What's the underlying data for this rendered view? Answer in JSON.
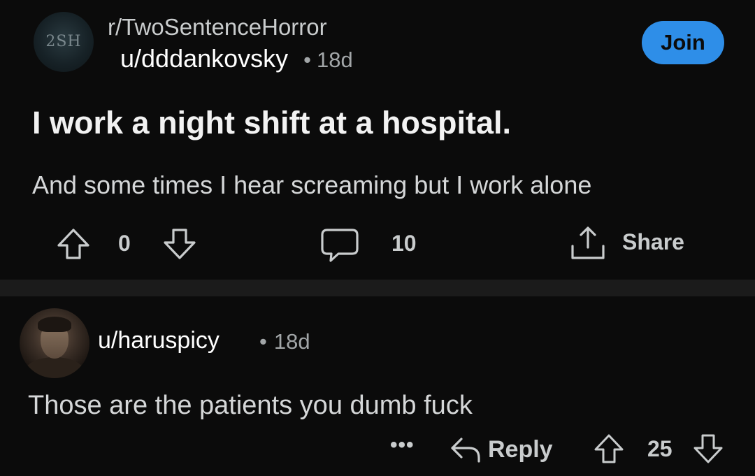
{
  "post": {
    "subreddit_avatar_text": "2SH",
    "subreddit": "r/TwoSentenceHorror",
    "author": "u/dddankovsky",
    "separator": "•",
    "age": "18d",
    "join_label": "Join",
    "title": "I work a night shift at a hospital.",
    "body": "And some times I hear screaming but I work alone",
    "actions": {
      "upvote_icon": "arrow-up-outline-icon",
      "vote_count": "0",
      "downvote_icon": "arrow-down-outline-icon",
      "comment_icon": "comment-bubble-icon",
      "comment_count": "10",
      "share_icon": "share-upload-icon",
      "share_label": "Share"
    }
  },
  "comment": {
    "author": "u/haruspicy",
    "separator": "•",
    "age": "18d",
    "body": "Those are the patients you dumb fuck",
    "actions": {
      "more_label": "•••",
      "reply_icon": "reply-arrow-icon",
      "reply_label": "Reply",
      "vote_count": "25"
    }
  },
  "colors": {
    "background": "#0b0b0b",
    "divider": "#1b1b1b",
    "join_button": "#2e8ee8",
    "primary_text": "#ffffff",
    "secondary_text": "#a2a6a8"
  }
}
